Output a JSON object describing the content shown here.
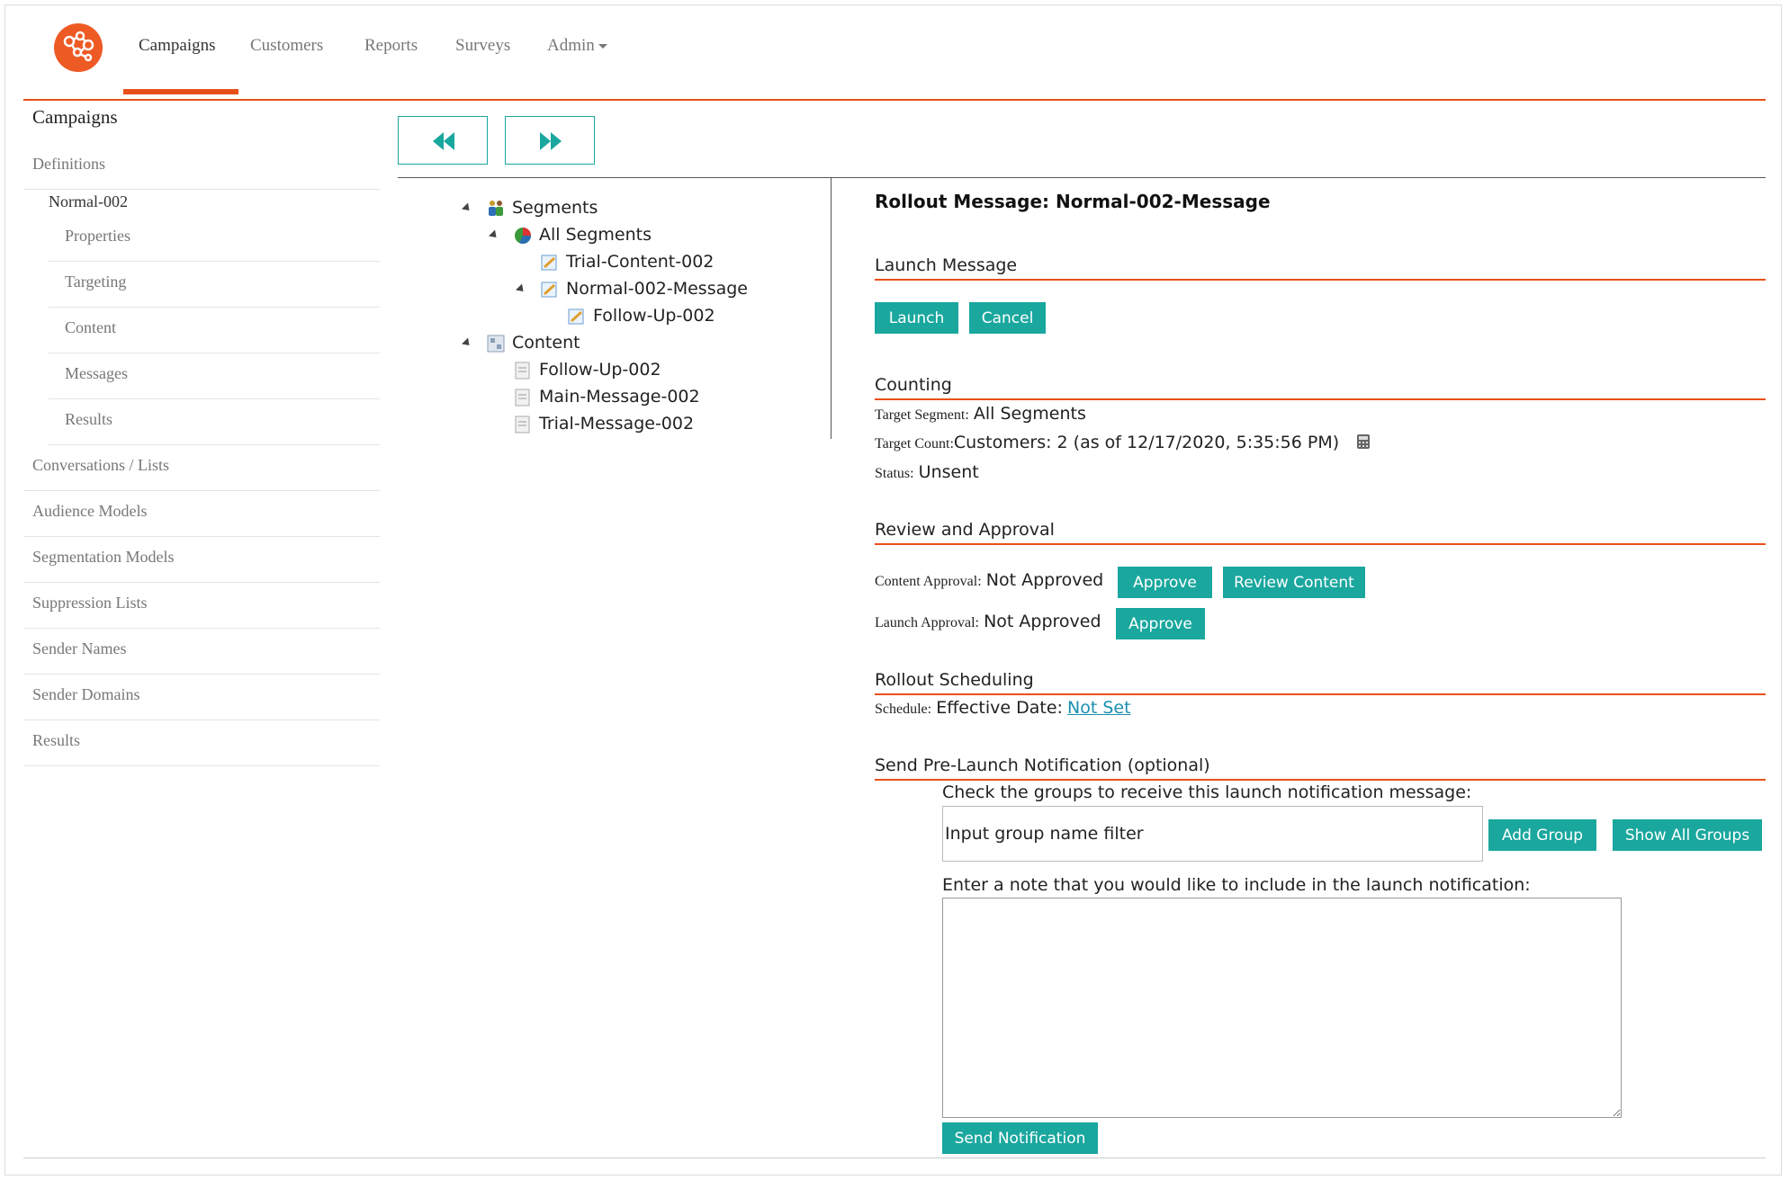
{
  "nav": {
    "items": [
      {
        "label": "Campaigns",
        "active": true
      },
      {
        "label": "Customers"
      },
      {
        "label": "Reports"
      },
      {
        "label": "Surveys"
      },
      {
        "label": "Admin"
      }
    ]
  },
  "sidebar": {
    "title": "Campaigns",
    "definitions": "Definitions",
    "current": "Normal-002",
    "sub_items": [
      "Properties",
      "Targeting",
      "Content",
      "Messages",
      "Results"
    ],
    "items": [
      "Conversations / Lists",
      "Audience Models",
      "Segmentation Models",
      "Suppression Lists",
      "Sender Names",
      "Sender Domains",
      "Results"
    ]
  },
  "tree": {
    "segments": "Segments",
    "all_segments": "All Segments",
    "trial_content": "Trial-Content-002",
    "normal_message": "Normal-002-Message",
    "follow_up_seg": "Follow-Up-002",
    "content": "Content",
    "follow_up": "Follow-Up-002",
    "main_message": "Main-Message-002",
    "trial_message": "Trial-Message-002"
  },
  "detail": {
    "title": "Rollout Message: Normal-002-Message",
    "launch": {
      "section": "Launch Message",
      "launch_label": "Launch",
      "cancel_label": "Cancel"
    },
    "counting": {
      "section": "Counting",
      "target_segment_label": "Target Segment:",
      "target_segment_value": "All Segments",
      "target_count_label": "Target Count:",
      "target_count_value": "Customers: 2 (as of 12/17/2020, 5:35:56 PM)",
      "status_label": "Status:",
      "status_value": "Unsent"
    },
    "review": {
      "section": "Review and Approval",
      "content_approval_label": "Content Approval:",
      "content_approval_value": "Not Approved",
      "approve_label": "Approve",
      "review_content_label": "Review Content",
      "launch_approval_label": "Launch Approval:",
      "launch_approval_value": "Not Approved",
      "approve2_label": "Approve"
    },
    "scheduling": {
      "section": "Rollout Scheduling",
      "schedule_label": "Schedule:",
      "effective_label": "Effective Date:",
      "effective_value": "Not Set"
    },
    "notification": {
      "section": "Send Pre-Launch Notification (optional)",
      "groups_prompt": "Check the groups to receive this launch notification message:",
      "filter_placeholder": "Input group name filter",
      "add_group_label": "Add Group",
      "show_all_label": "Show All Groups",
      "note_prompt": "Enter a note that you would like to include in the launch notification:",
      "send_label": "Send Notification"
    }
  },
  "colors": {
    "accent": "#e8501a",
    "button": "#1aa79e",
    "link": "#1a8fb0"
  }
}
